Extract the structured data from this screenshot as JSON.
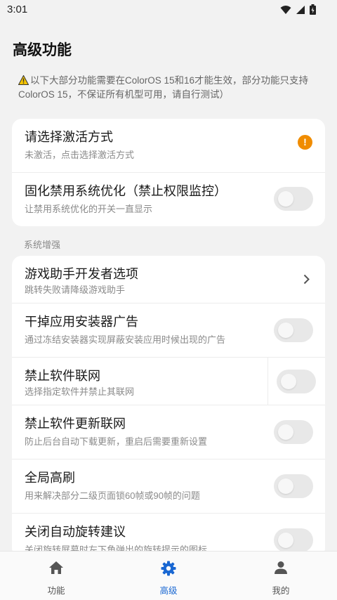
{
  "status_bar": {
    "time": "3:01"
  },
  "page_title": "高级功能",
  "notice": "以下大部分功能需要在ColorOS 15和16才能生效，部分功能只支持ColorOS 15，不保证所有机型可用，请自行测试）",
  "top_card": [
    {
      "title": "请选择激活方式",
      "subtitle": "未激活，点击选择激活方式",
      "badge": "!"
    },
    {
      "title": "固化禁用系统优化（禁止权限监控）",
      "subtitle": "让禁用系统优化的开关一直显示",
      "toggle": false
    }
  ],
  "section_label": "系统增强",
  "main_card": [
    {
      "title": "游戏助手开发者选项",
      "subtitle": "跳转失败请降级游戏助手"
    },
    {
      "title": "干掉应用安装器广告",
      "subtitle": "通过冻结安装器实现屏蔽安装应用时候出现的广告",
      "toggle": false
    },
    {
      "title": "禁止软件联网",
      "subtitle": "选择指定软件并禁止其联网",
      "toggle": false
    },
    {
      "title": "禁止软件更新联网",
      "subtitle": "防止后台自动下载更新，重启后需要重新设置",
      "toggle": false
    },
    {
      "title": "全局高刷",
      "subtitle": "用来解决部分二级页面锁60帧或90帧的问题",
      "toggle": false
    },
    {
      "title": "关闭自动旋转建议",
      "subtitle": "关闭旋转屏幕时左下角弹出的旋转提示的图标",
      "toggle": false
    }
  ],
  "bottom_nav": [
    {
      "label": "功能",
      "icon": "home-icon",
      "active": false
    },
    {
      "label": "高级",
      "icon": "gear-icon",
      "active": true
    },
    {
      "label": "我的",
      "icon": "person-icon",
      "active": false
    }
  ],
  "colors": {
    "accent": "#1967d2",
    "warning": "#f08c00",
    "background": "#f2f2f2"
  }
}
